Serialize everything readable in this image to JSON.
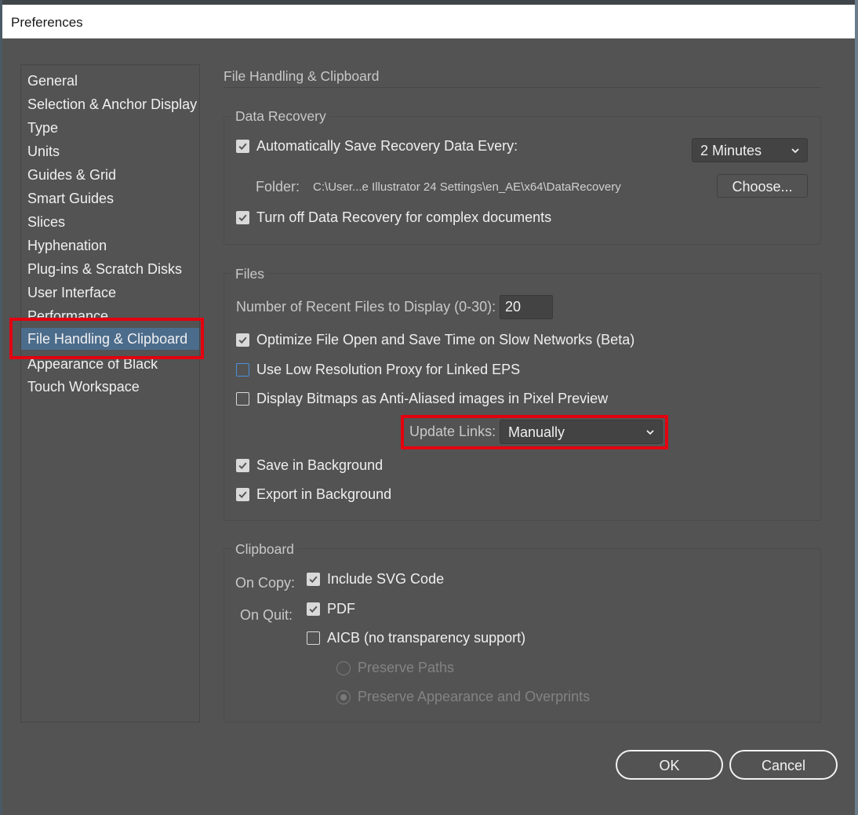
{
  "window": {
    "title": "Preferences"
  },
  "sidebar": {
    "items": [
      {
        "label": "General"
      },
      {
        "label": "Selection & Anchor Display"
      },
      {
        "label": "Type"
      },
      {
        "label": "Units"
      },
      {
        "label": "Guides & Grid"
      },
      {
        "label": "Smart Guides"
      },
      {
        "label": "Slices"
      },
      {
        "label": "Hyphenation"
      },
      {
        "label": "Plug-ins & Scratch Disks"
      },
      {
        "label": "User Interface"
      },
      {
        "label": "Performance"
      },
      {
        "label": "File Handling & Clipboard"
      },
      {
        "label": "Appearance of Black"
      },
      {
        "label": "Touch Workspace"
      }
    ],
    "selected": "File Handling & Clipboard"
  },
  "page": {
    "title": "File Handling & Clipboard"
  },
  "data_recovery": {
    "legend": "Data Recovery",
    "auto_save_label": "Automatically Save Recovery Data Every:",
    "auto_save_checked": true,
    "interval": "2 Minutes",
    "folder_label": "Folder:",
    "folder_path": "C:\\User...e Illustrator 24 Settings\\en_AE\\x64\\DataRecovery",
    "choose_label": "Choose...",
    "turn_off_label": "Turn off Data Recovery for complex documents",
    "turn_off_checked": true
  },
  "files": {
    "legend": "Files",
    "recent_label": "Number of Recent Files to Display (0-30):",
    "recent_value": "20",
    "optimize_label": "Optimize File Open and Save Time on Slow Networks (Beta)",
    "optimize_checked": true,
    "low_res_label": "Use Low Resolution Proxy for Linked EPS",
    "low_res_checked": false,
    "bitmaps_label": "Display Bitmaps as Anti-Aliased images in Pixel Preview",
    "bitmaps_checked": false,
    "update_links_label": "Update Links:",
    "update_links_value": "Manually",
    "save_bg_label": "Save in Background",
    "save_bg_checked": true,
    "export_bg_label": "Export in Background",
    "export_bg_checked": true
  },
  "clipboard": {
    "legend": "Clipboard",
    "on_copy_label": "On Copy:",
    "svg_label": "Include SVG Code",
    "svg_checked": true,
    "on_quit_label": "On Quit:",
    "pdf_label": "PDF",
    "pdf_checked": true,
    "aicb_label": "AICB (no transparency support)",
    "aicb_checked": false,
    "preserve_paths_label": "Preserve Paths",
    "preserve_appearance_label": "Preserve Appearance and Overprints",
    "preserve_selected": "Preserve Appearance and Overprints"
  },
  "footer": {
    "ok_label": "OK",
    "cancel_label": "Cancel"
  },
  "colors": {
    "dialog_bg": "#535353",
    "selection": "#4c6c8c",
    "highlight": "#e3000f",
    "focus": "#4a90d9"
  },
  "icons": {
    "checkmark": "checkmark-icon",
    "chevron": "chevron-down-icon"
  }
}
